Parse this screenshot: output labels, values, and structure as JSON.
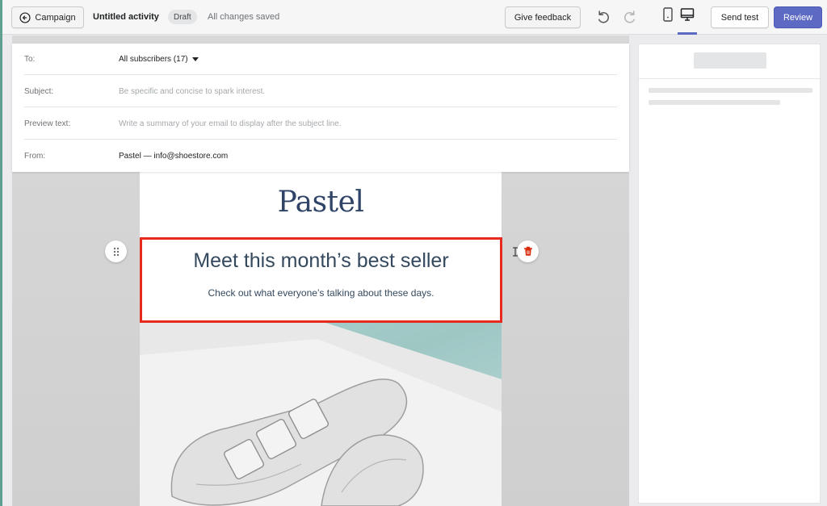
{
  "topbar": {
    "back_label": "Campaign",
    "title": "Untitled activity",
    "status_badge": "Draft",
    "save_status": "All changes saved",
    "feedback_label": "Give feedback",
    "send_test_label": "Send test",
    "review_label": "Review",
    "active_view": "desktop"
  },
  "email_header": {
    "to": {
      "label": "To:",
      "value": "All subscribers (17)"
    },
    "subject": {
      "label": "Subject:",
      "placeholder": "Be specific and concise to spark interest."
    },
    "preview_text": {
      "label": "Preview text:",
      "placeholder": "Write a summary of your email to display after the subject line."
    },
    "from": {
      "label": "From:",
      "value": "Pastel — info@shoestore.com"
    }
  },
  "email_body": {
    "logo": "Pastel",
    "headline": "Meet this month’s best seller",
    "subheadline": "Check out what everyone’s talking about these days."
  },
  "colors": {
    "accent": "#5c6ac4",
    "selection": "#e62b1e",
    "delete_icon": "#d82c0d",
    "heading_text": "#34495e",
    "logo_text": "#2f4466"
  }
}
